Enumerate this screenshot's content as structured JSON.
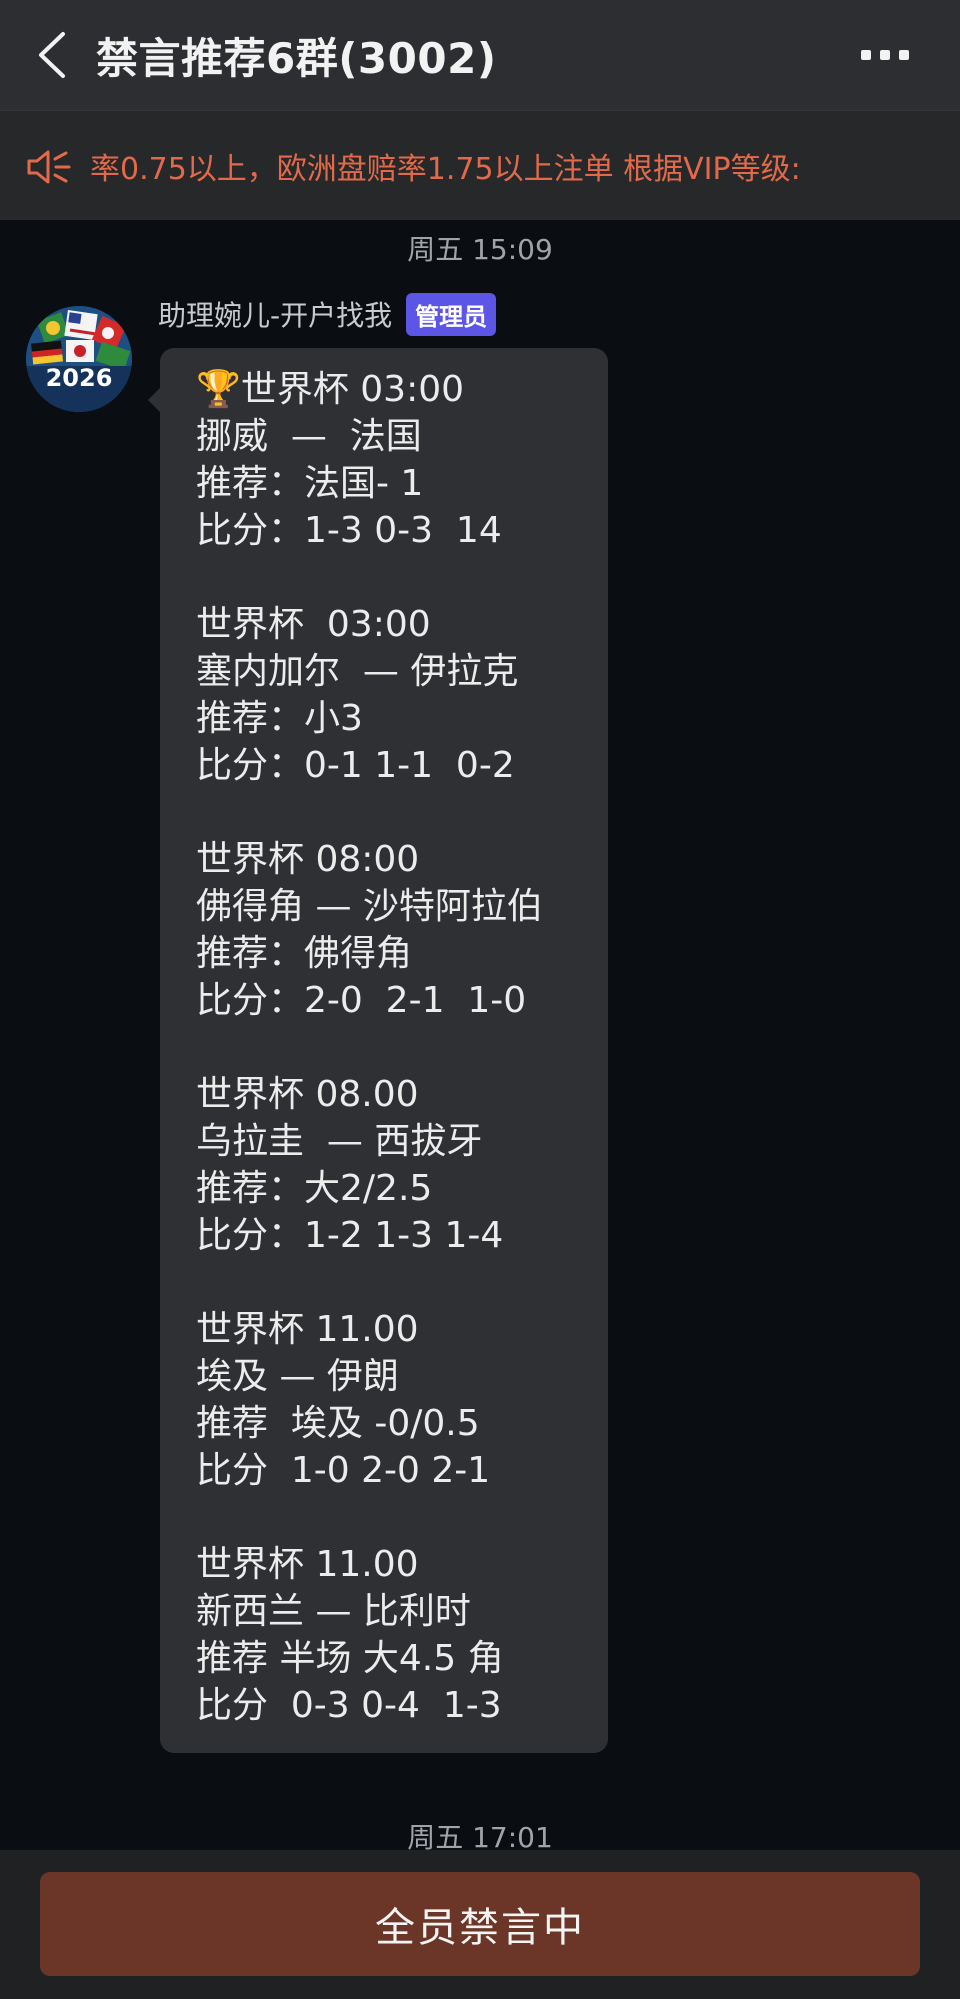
{
  "header": {
    "title": "禁言推荐6群(3002)"
  },
  "notice": {
    "text": "率0.75以上，欧洲盘赔率1.75以上注单 根据VIP等级:"
  },
  "chat": {
    "timestamps": [
      "周五 15:09",
      "周五 17:01"
    ],
    "message": {
      "sender": "助理婉儿-开户找我",
      "badge": "管理员",
      "avatar_text": "2026",
      "lines": [
        "🏆世界杯 03:00",
        "挪威  —  法国",
        "推荐：法国- 1",
        "比分：1-3 0-3  14",
        "",
        "世界杯  03:00",
        "塞内加尔  — 伊拉克",
        "推荐：小3",
        "比分：0-1 1-1  0-2",
        "",
        "世界杯 08:00",
        "佛得角 — 沙特阿拉伯",
        "推荐：佛得角",
        "比分：2-0  2-1  1-0",
        "",
        "世界杯 08.00",
        "乌拉圭  — 西拔牙",
        "推荐：大2/2.5",
        "比分：1-2 1-3 1-4",
        "",
        "世界杯 11.00",
        "埃及 — 伊朗",
        "推荐  埃及 -0/0.5",
        "比分  1-0 2-0 2-1",
        "",
        "世界杯 11.00",
        "新西兰 — 比利时",
        "推荐 半场 大4.5 角",
        "比分  0-3 0-4  1-3"
      ]
    }
  },
  "bottom": {
    "button_label": "全员禁言中"
  },
  "colors": {
    "header_bg": "#2c2e31",
    "notice_text": "#e26a4a",
    "bubble_bg": "#2e3034",
    "badge_bg": "#5c55e6",
    "muted_button_bg": "#6b3527"
  },
  "icons": [
    "back-chevron-icon",
    "more-dots-icon",
    "speaker-icon",
    "avatar-ball-icon"
  ]
}
